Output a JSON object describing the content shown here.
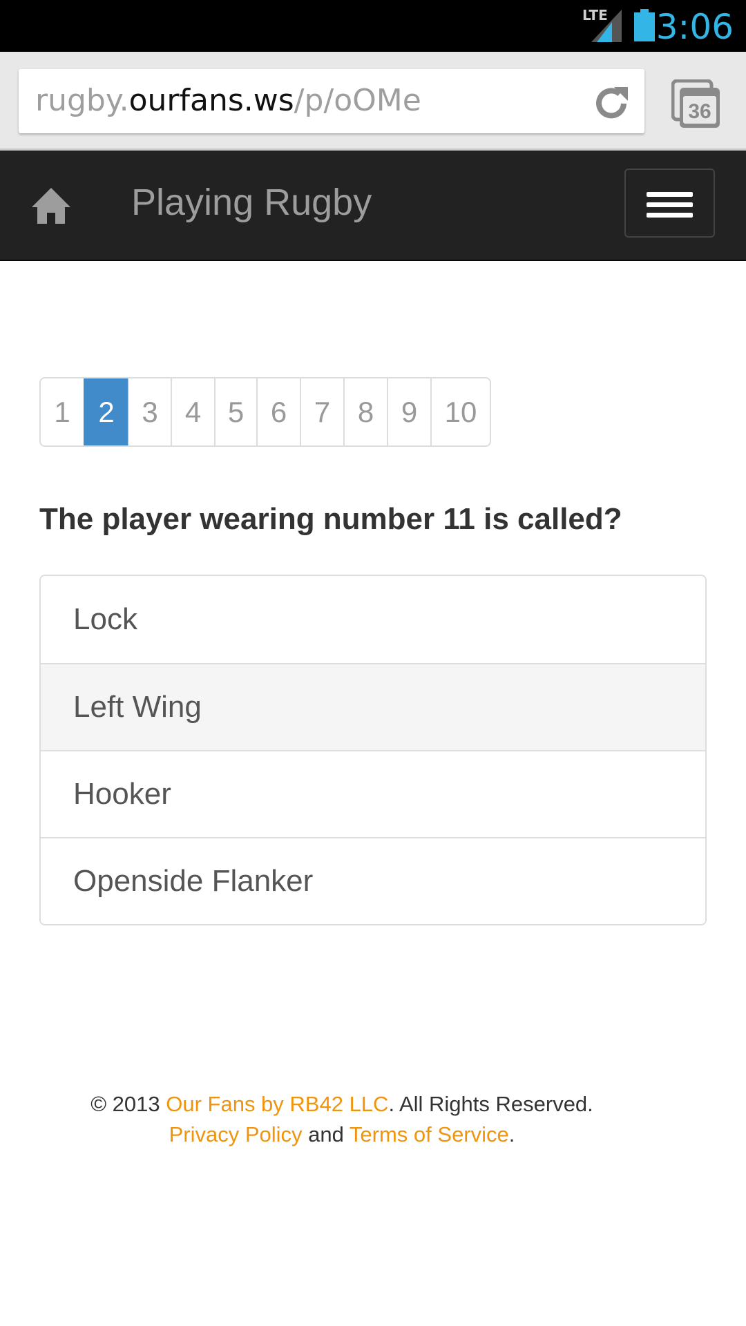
{
  "status": {
    "network": "LTE",
    "time": "3:06"
  },
  "browser": {
    "url_prefix": "rugby.",
    "url_host": "ourfans.ws",
    "url_path": "/p/oOMe",
    "tab_count": "36"
  },
  "navbar": {
    "brand": "Playing Rugby"
  },
  "pagination": {
    "pages": [
      "1",
      "2",
      "3",
      "4",
      "5",
      "6",
      "7",
      "8",
      "9",
      "10"
    ],
    "active_page": "2"
  },
  "quiz": {
    "question": "The player wearing number 11 is called?",
    "answers": [
      "Lock",
      "Left Wing",
      "Hooker",
      "Openside Flanker"
    ]
  },
  "footer": {
    "copyright": "© 2013 ",
    "company_link": "Our Fans by RB42 LLC",
    "rights": ". All Rights Reserved.",
    "privacy_link": "Privacy Policy",
    "and": " and ",
    "terms_link": "Terms of Service",
    "period": "."
  },
  "colors": {
    "accent": "#428bca",
    "link": "#f0940d",
    "navbar": "#222222",
    "clock": "#33b5e5"
  },
  "icons": [
    "signal-icon",
    "battery-icon",
    "reload-icon",
    "tabs-icon",
    "home-icon",
    "menu-icon"
  ]
}
